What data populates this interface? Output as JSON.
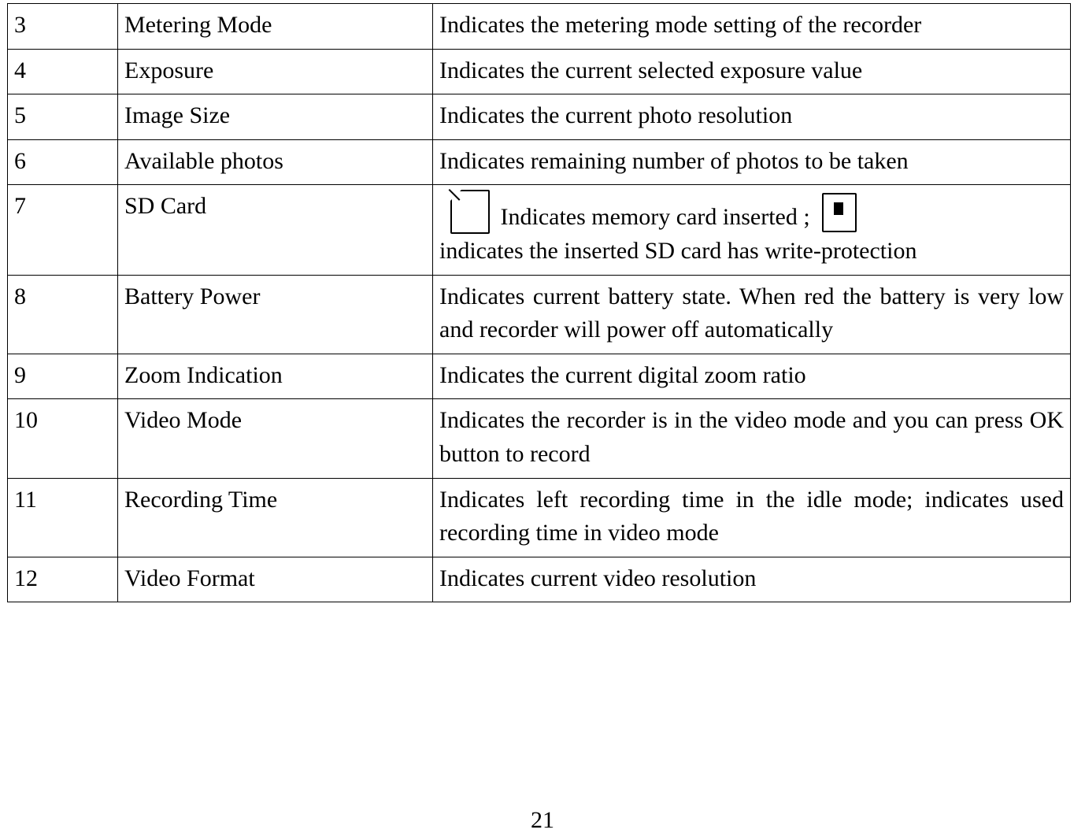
{
  "document": {
    "page_number": "21",
    "table": {
      "columns": [
        "number",
        "name",
        "description"
      ],
      "rows": [
        {
          "number": "3",
          "name": "Metering Mode",
          "description": "Indicates the metering mode setting of the recorder",
          "justify": true
        },
        {
          "number": "4",
          "name": "Exposure",
          "description": "Indicates the current selected exposure value",
          "justify": false
        },
        {
          "number": "5",
          "name": "Image Size",
          "description": "Indicates the current photo resolution",
          "justify": false
        },
        {
          "number": "6",
          "name": "Available photos",
          "description": "Indicates remaining number of photos to be taken",
          "justify": false
        },
        {
          "number": "7",
          "name": "SD Card",
          "description_part1": "Indicates memory card inserted ;",
          "description_part2": "indicates the inserted SD card has write-protection",
          "icons": [
            "sd-card-icon",
            "sd-card-write-protected-icon"
          ],
          "justify": false
        },
        {
          "number": "8",
          "name": "Battery Power",
          "description": "Indicates current battery state. When red the battery is very low and recorder will power off automatically",
          "justify": true
        },
        {
          "number": "9",
          "name": "Zoom Indication",
          "description": "Indicates the current digital zoom ratio",
          "justify": false
        },
        {
          "number": "10",
          "name": "Video Mode",
          "description": "Indicates the recorder is in the video mode and you can press OK button to record",
          "justify": true
        },
        {
          "number": "11",
          "name": "Recording Time",
          "description": "Indicates left recording time in the idle mode; indicates used recording time in video mode",
          "justify": true
        },
        {
          "number": "12",
          "name": "Video Format",
          "description": "Indicates current video resolution",
          "justify": false
        }
      ]
    }
  }
}
